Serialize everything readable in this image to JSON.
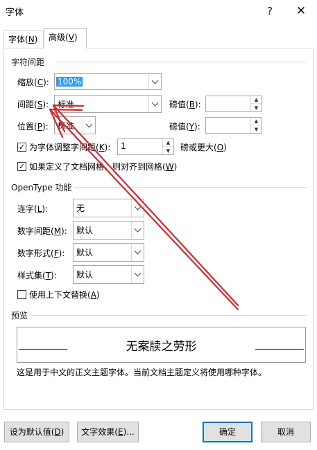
{
  "window": {
    "title": "字体",
    "help_glyph": "?",
    "close_glyph": "✕"
  },
  "tabs": [
    {
      "label": "字体(",
      "key": "N",
      "suffix": ")",
      "active": false
    },
    {
      "label": "高级(",
      "key": "V",
      "suffix": ")",
      "active": true
    }
  ],
  "spacing_section": {
    "title": "字符间距",
    "scale": {
      "label": "缩放(",
      "key": "C",
      "suffix": "):",
      "value": "100%"
    },
    "spacing": {
      "label": "间距(",
      "key": "S",
      "suffix": "):",
      "value": "标准"
    },
    "position": {
      "label": "位置(",
      "key": "P",
      "suffix": "):",
      "value": "标准"
    },
    "spacing_by": {
      "label": "磅值(",
      "key": "B",
      "suffix": "):",
      "value": ""
    },
    "position_by": {
      "label": "磅值(",
      "key": "Y",
      "suffix": "):",
      "value": ""
    },
    "kerning": {
      "checked": true,
      "label": "为字体调整字间距(",
      "key": "K",
      "suffix": "):",
      "value": "1",
      "after_label": "磅或更大(",
      "after_key": "O",
      "after_suffix": ")"
    },
    "snap_grid": {
      "checked": true,
      "label": "如果定义了文档网格，则对齐到网格(",
      "key": "W",
      "suffix": ")"
    }
  },
  "opentype_section": {
    "title": "OpenType 功能",
    "ligatures": {
      "label": "连字(",
      "key": "L",
      "suffix": "):",
      "value": "无"
    },
    "number_spacing": {
      "label": "数字间距(",
      "key": "M",
      "suffix": "):",
      "value": "默认"
    },
    "number_forms": {
      "label": "数字形式(",
      "key": "F",
      "suffix": "):",
      "value": "默认"
    },
    "stylistic_sets": {
      "label": "样式集(",
      "key": "T",
      "suffix": "):",
      "value": "默认"
    },
    "contextual": {
      "checked": false,
      "label": "使用上下文替换(",
      "key": "A",
      "suffix": ")"
    }
  },
  "preview": {
    "title": "预览",
    "sample": "无案牍之劳形",
    "description": "这是用于中文的正文主题字体。当前文档主题定义将使用哪种字体。"
  },
  "buttons": {
    "set_default": {
      "label": "设为默认值(",
      "key": "D",
      "suffix": ")"
    },
    "text_effects": {
      "label": "文字效果(",
      "key": "E",
      "suffix": ")..."
    },
    "ok": "确定",
    "cancel": "取消"
  },
  "colors": {
    "accent": "#0078d7",
    "selection": "#3399ff",
    "annotation_arrow": "#d9262c"
  },
  "icons": {
    "dropdown": "chevron-down-icon",
    "spin_up": "spin-up-icon",
    "spin_down": "spin-down-icon",
    "check": "check-icon"
  }
}
